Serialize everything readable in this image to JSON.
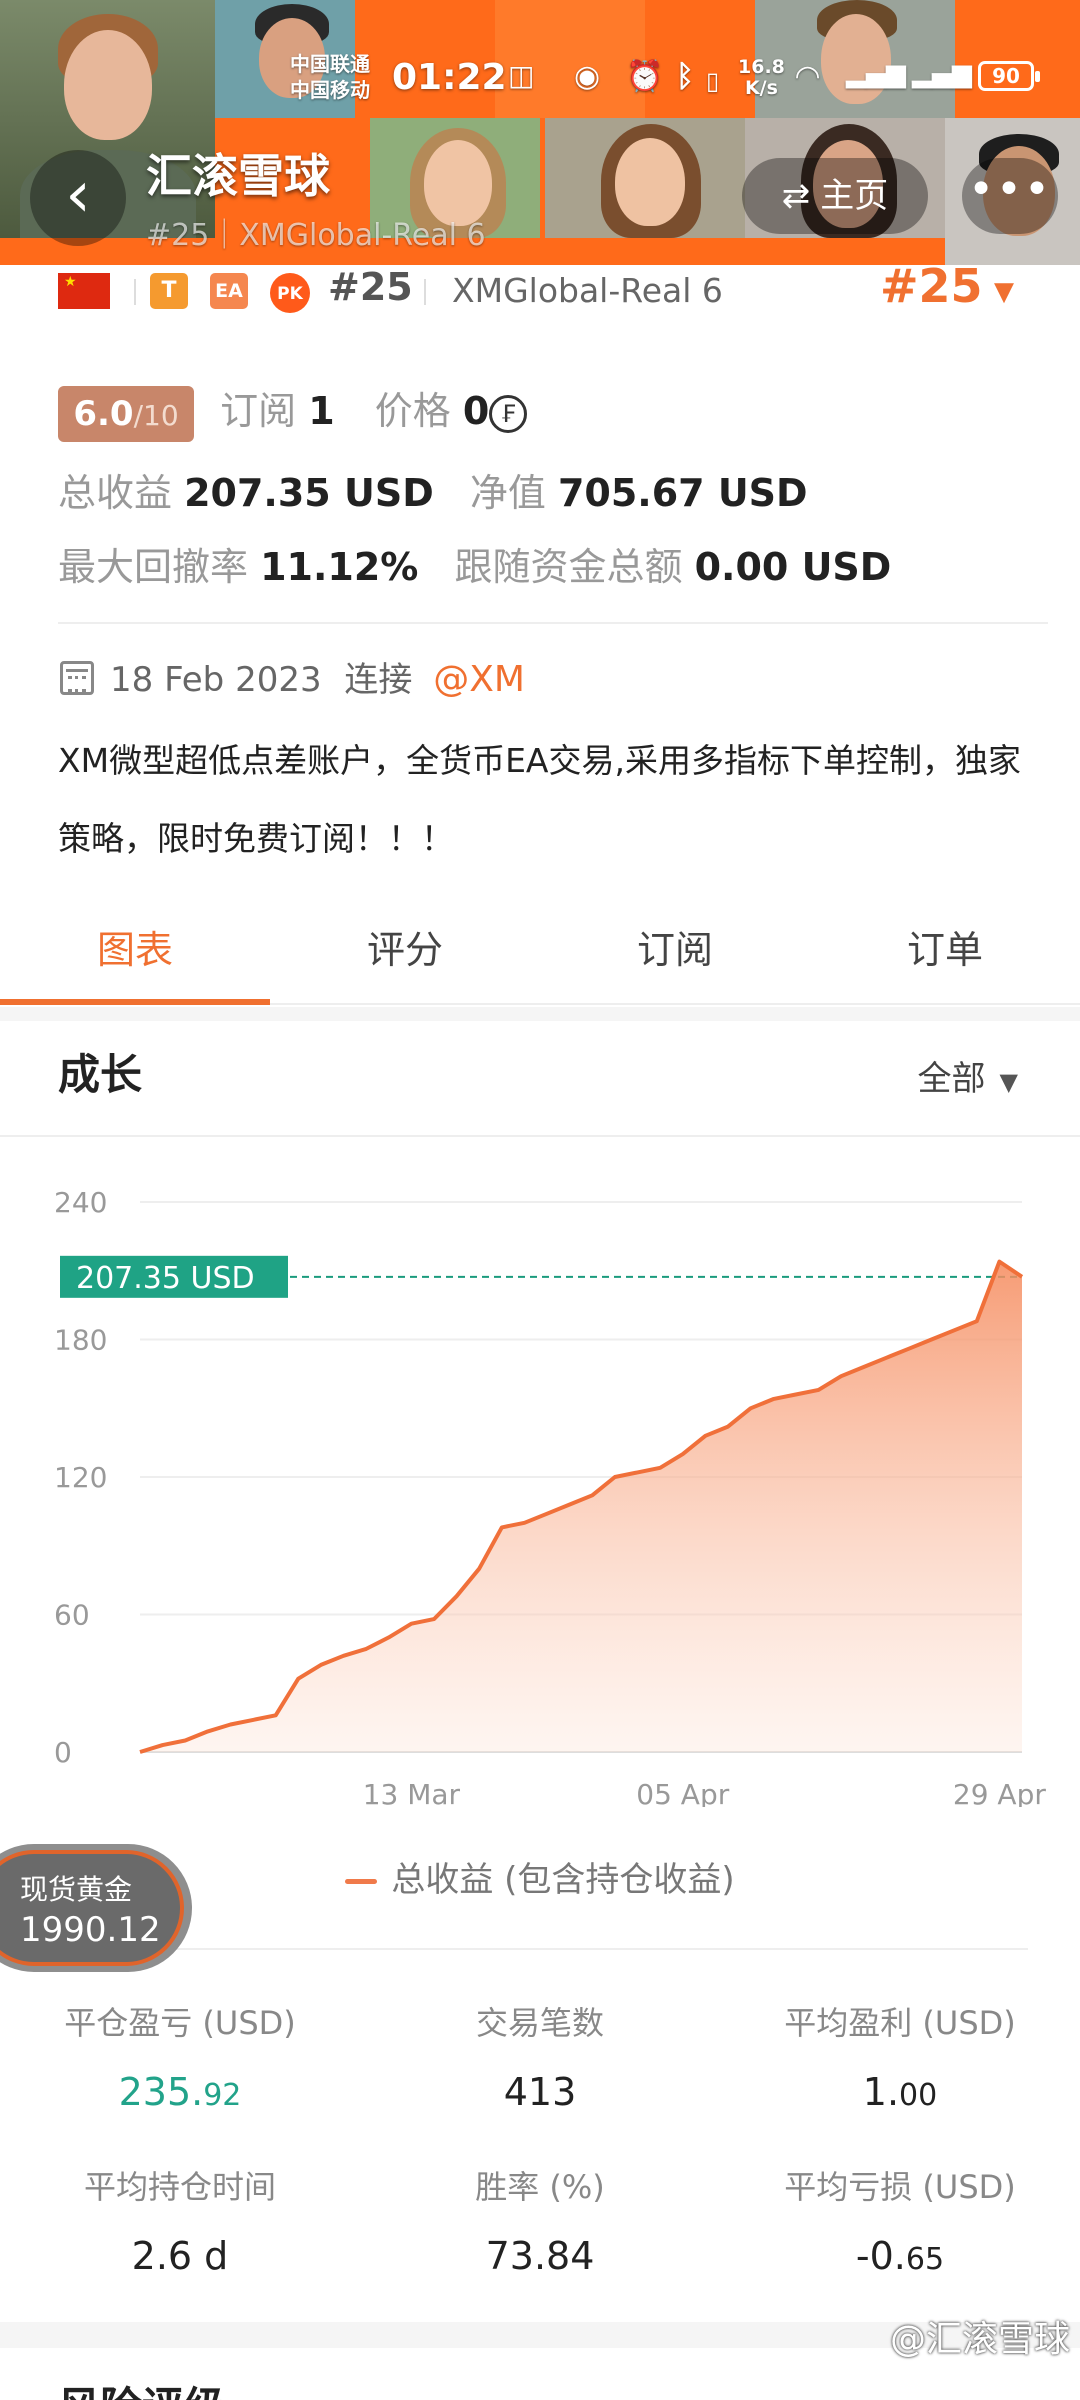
{
  "status_bar": {
    "carrier1": "中国联通",
    "carrier2": "中国移动",
    "time": "01:22",
    "net_speed_value": "16.8",
    "net_speed_unit": "K/s",
    "battery": "90"
  },
  "header": {
    "app_title": "汇滚雪球",
    "subtitle": "#25｜XMGlobal-Real 6",
    "home_label": "主页",
    "more_label": "•••"
  },
  "account": {
    "badge_t": "T",
    "badge_ea": "EA",
    "badge_pk": "PK",
    "rank": "#25",
    "server": "XMGlobal-Real 6",
    "rank_big": "#25"
  },
  "stats": {
    "score": "6.0",
    "score_max": "/10",
    "subscribe_label": "订阅",
    "subscribe_count": "1",
    "price_label": "价格",
    "price_value": "0",
    "total_profit_label": "总收益",
    "total_profit_value": "207.35 USD",
    "net_value_label": "净值",
    "net_value_value": "705.67 USD",
    "max_drawdown_label": "最大回撤率",
    "max_drawdown_value": "11.12%",
    "follow_funds_label": "跟随资金总额",
    "follow_funds_value": "0.00 USD"
  },
  "info": {
    "date": "18 Feb 2023",
    "connect_label": "连接",
    "broker_link": "@XM",
    "description": "XM微型超低点差账户，全货币EA交易,采用多指标下单控制，独家策略，限时免费订阅！！！"
  },
  "tabs": [
    {
      "label": "图表",
      "active": true
    },
    {
      "label": "评分",
      "active": false
    },
    {
      "label": "订阅",
      "active": false
    },
    {
      "label": "订单",
      "active": false
    }
  ],
  "section": {
    "title": "成长",
    "filter": "全部"
  },
  "chart_data": {
    "type": "area",
    "series": [
      {
        "name": "总收益 (包含持仓收益)",
        "x": [
          "Feb 19",
          "Feb 21",
          "Feb 23",
          "Feb 25",
          "Feb 27",
          "Mar 1",
          "Mar 2",
          "Mar 4",
          "Mar 6",
          "Mar 8",
          "Mar 10",
          "Mar 11",
          "Mar 13",
          "Mar 15",
          "Mar 17",
          "Mar 18",
          "Mar 20",
          "Mar 22",
          "Mar 24",
          "Mar 26",
          "Mar 28",
          "Mar 30",
          "Apr 1",
          "Apr 3",
          "Apr 5",
          "Apr 7",
          "Apr 9",
          "Apr 11",
          "Apr 13",
          "Apr 15",
          "Apr 17",
          "Apr 19",
          "Apr 21",
          "Apr 23",
          "Apr 25",
          "Apr 27",
          "Apr 28",
          "Apr 29",
          "Apr 30",
          "May 1"
        ],
        "values": [
          0,
          3,
          5,
          9,
          12,
          14,
          16,
          32,
          38,
          42,
          45,
          50,
          56,
          58,
          68,
          80,
          98,
          100,
          104,
          108,
          112,
          120,
          122,
          124,
          130,
          138,
          142,
          150,
          154,
          156,
          158,
          164,
          168,
          172,
          176,
          180,
          184,
          188,
          214,
          207.35
        ]
      }
    ],
    "ylim": [
      0,
      240
    ],
    "yticks": [
      0,
      60,
      120,
      180,
      240
    ],
    "xtick_labels": [
      "13 Mar",
      "05 Apr",
      "29 Apr"
    ],
    "current_value_label": "207.35 USD",
    "grid": true,
    "legend_position": "bottom"
  },
  "legend": {
    "label": "总收益 (包含持仓收益)"
  },
  "gold": {
    "label": "现货黄金",
    "value": "1990.12"
  },
  "metrics": [
    {
      "label": "平仓盈亏 (USD)",
      "value_main": "235.",
      "value_small": "92",
      "color": "#22a38a"
    },
    {
      "label": "交易笔数",
      "value_main": "413",
      "value_small": "",
      "color": "#222222"
    },
    {
      "label": "平均盈利 (USD)",
      "value_main": "1.",
      "value_small": "00",
      "color": "#222222"
    },
    {
      "label": "平均持仓时间",
      "value_main": "2.6 d",
      "value_small": "",
      "color": "#222222"
    },
    {
      "label": "胜率 (%)",
      "value_main": "73.84",
      "value_small": "",
      "color": "#222222"
    },
    {
      "label": "平均亏损 (USD)",
      "value_main": "-0.",
      "value_small": "65",
      "color": "#222222"
    }
  ],
  "watermark": "@汇滚雪球",
  "next_section_title": "风险评级"
}
